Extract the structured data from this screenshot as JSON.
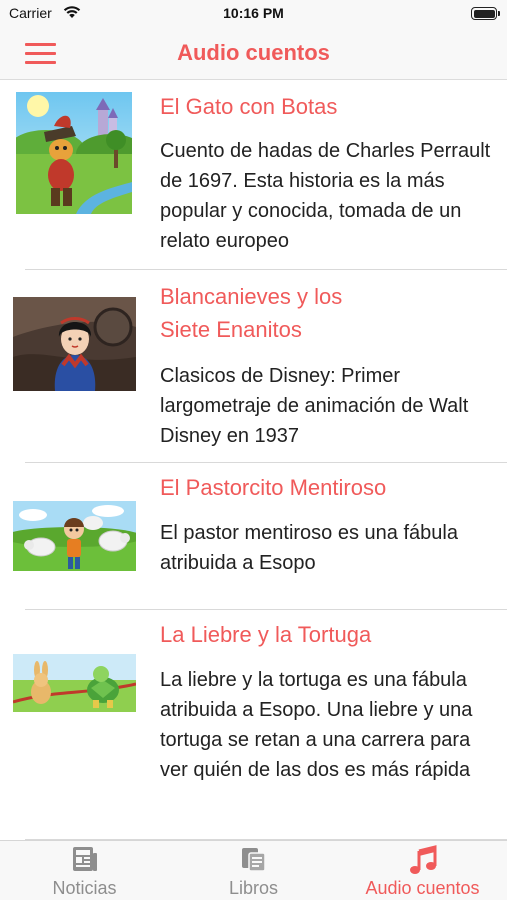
{
  "status_bar": {
    "carrier": "Carrier",
    "time": "10:16 PM"
  },
  "nav": {
    "title": "Audio cuentos"
  },
  "stories": [
    {
      "title": "El Gato con Botas",
      "description": "Cuento de hadas de Charles Perrault de 1697. Esta historia es la más popular y conocida, tomada de un relato europeo",
      "image": "puss-in-boots-thumbnail"
    },
    {
      "title_line1": "Blancanieves y los",
      "title_line2": "Siete Enanitos",
      "description": "Clasicos de Disney: Primer largometraje de animación de Walt Disney en 1937",
      "image": "snow-white-thumbnail"
    },
    {
      "title": "El Pastorcito Mentiroso",
      "description": "El pastor mentiroso es una fábula atribuida a Esopo",
      "image": "shepherd-boy-thumbnail"
    },
    {
      "title": "La Liebre y la Tortuga",
      "description": "La liebre y la tortuga es una fábula atribuida a Esopo. Una liebre y una tortuga se retan a una carrera para ver quién de las dos es más rápida",
      "image": "hare-tortoise-thumbnail"
    }
  ],
  "tabs": [
    {
      "label": "Noticias",
      "icon": "newspaper-icon",
      "active": false
    },
    {
      "label": "Libros",
      "icon": "books-icon",
      "active": false
    },
    {
      "label": "Audio cuentos",
      "icon": "music-note-icon",
      "active": true
    }
  ],
  "colors": {
    "accent": "#f05a5a",
    "inactive": "#8e8e8e",
    "bar_bg": "#f8f8f8"
  }
}
